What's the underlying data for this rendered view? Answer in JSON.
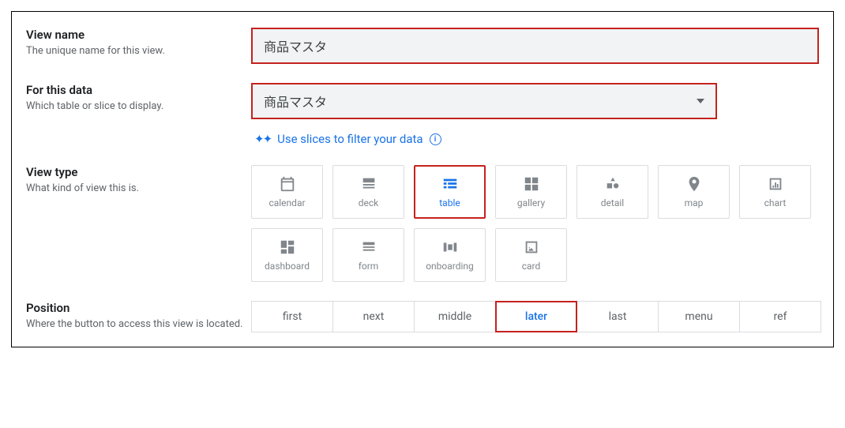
{
  "view_name": {
    "title": "View name",
    "desc": "The unique name for this view.",
    "value": "商品マスタ"
  },
  "for_data": {
    "title": "For this data",
    "desc": "Which table or slice to display.",
    "selected": "商品マスタ",
    "slices_link": "Use slices to filter your data"
  },
  "view_type": {
    "title": "View type",
    "desc": "What kind of view this is.",
    "options": [
      {
        "key": "calendar",
        "label": "calendar"
      },
      {
        "key": "deck",
        "label": "deck"
      },
      {
        "key": "table",
        "label": "table",
        "selected": true
      },
      {
        "key": "gallery",
        "label": "gallery"
      },
      {
        "key": "detail",
        "label": "detail"
      },
      {
        "key": "map",
        "label": "map"
      },
      {
        "key": "chart",
        "label": "chart"
      },
      {
        "key": "dashboard",
        "label": "dashboard"
      },
      {
        "key": "form",
        "label": "form"
      },
      {
        "key": "onboarding",
        "label": "onboarding"
      },
      {
        "key": "card",
        "label": "card"
      }
    ]
  },
  "position": {
    "title": "Position",
    "desc": "Where the button to access this view is located.",
    "options": [
      {
        "key": "first",
        "label": "first"
      },
      {
        "key": "next",
        "label": "next"
      },
      {
        "key": "middle",
        "label": "middle"
      },
      {
        "key": "later",
        "label": "later",
        "selected": true
      },
      {
        "key": "last",
        "label": "last"
      },
      {
        "key": "menu",
        "label": "menu"
      },
      {
        "key": "ref",
        "label": "ref"
      }
    ]
  }
}
